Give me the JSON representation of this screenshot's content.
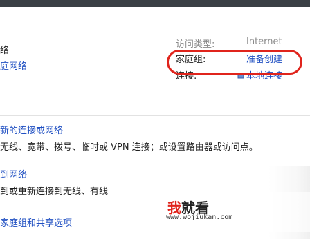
{
  "network": {
    "title_partial": "络",
    "type_link_partial": "庭网络"
  },
  "info": {
    "access_type_label": "访问类型:",
    "access_type_value": "Internet",
    "homegroup_label": "家庭组:",
    "homegroup_value": "准备创建",
    "connections_label": "连接:",
    "connections_value": "本地连接"
  },
  "tasks": {
    "new_connection_link": "新的连接或网络",
    "new_connection_desc": "无线、宽带、拨号、临时或 VPN 连接；或设置路由器或访问点。",
    "connect_link": "到网络",
    "connect_desc": "到或重新连接到无线、有线",
    "homegroup_link": "家庭组和共享选项"
  },
  "watermark": {
    "logo_wo": "我",
    "logo_rest": "就看",
    "url": "www.wojiukan.com"
  },
  "colors": {
    "link": "#1f4fc2",
    "highlight": "#e0241c"
  }
}
